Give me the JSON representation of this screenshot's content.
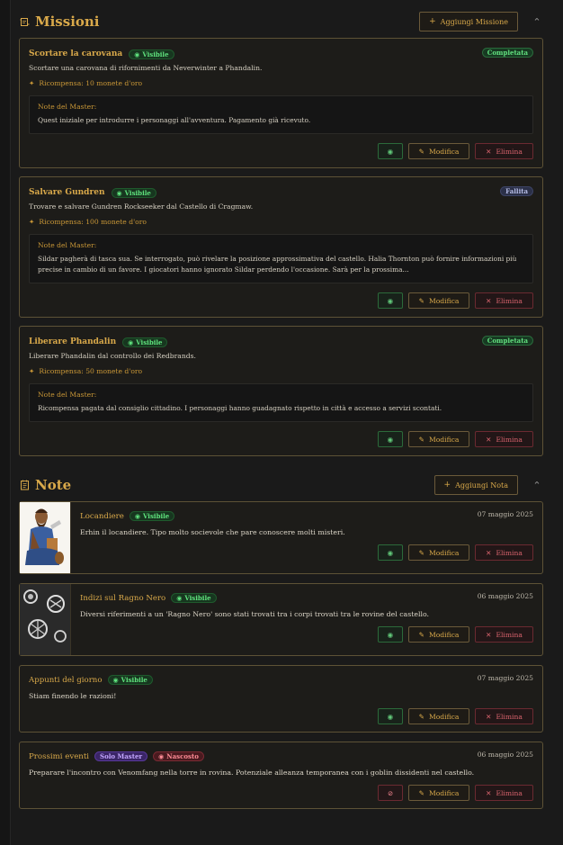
{
  "missions": {
    "title": "Missioni",
    "add_label": "Aggiungi Missione",
    "items": [
      {
        "title": "Scortare la carovana",
        "visibility": "Visibile",
        "status": "Completata",
        "description": "Scortare una carovana di rifornimenti da Neverwinter a Phandalin.",
        "reward": "Ricompensa: 10 monete d'oro",
        "master_label": "Note del Master:",
        "master_text": "Quest iniziale per introdurre i personaggi all'avventura. Pagamento già ricevuto."
      },
      {
        "title": "Salvare Gundren",
        "visibility": "Visibile",
        "status": "Fallita",
        "description": "Trovare e salvare Gundren Rockseeker dal Castello di Cragmaw.",
        "reward": "Ricompensa: 100 monete d'oro",
        "master_label": "Note del Master:",
        "master_text": "Sildar pagherà di tasca sua. Se interrogato, può rivelare la posizione approssimativa del castello. Halia Thornton può fornire informazioni più precise in cambio di un favore. I giocatori hanno ignorato Sildar perdendo l'occasione. Sarà per la prossima..."
      },
      {
        "title": "Liberare Phandalin",
        "visibility": "Visibile",
        "status": "Completata",
        "description": "Liberare Phandalin dal controllo dei Redbrands.",
        "reward": "Ricompensa: 50 monete d'oro",
        "master_label": "Note del Master:",
        "master_text": "Ricompensa pagata dal consiglio cittadino. I personaggi hanno guadagnato rispetto in città e accesso a servizi scontati."
      }
    ]
  },
  "notes": {
    "title": "Note",
    "add_label": "Aggiungi Nota",
    "items": [
      {
        "title": "Locandiere",
        "badge1": "Visibile",
        "date": "07 maggio 2025",
        "text": "Erhin il locandiere. Tipo molto socievole che pare conoscere molti misteri."
      },
      {
        "title": "Indizi sul Ragno Nero",
        "badge1": "Visibile",
        "date": "06 maggio 2025",
        "text": "Diversi riferimenti a un 'Ragno Nero' sono stati trovati tra i corpi trovati tra le rovine del castello."
      },
      {
        "title": "Appunti del giorno",
        "badge1": "Visibile",
        "date": "07 maggio 2025",
        "text": "Stiam finendo le razioni!"
      },
      {
        "title": "Prossimi eventi",
        "badge1": "Solo Master",
        "badge2": "Nascosto",
        "date": "06 maggio 2025",
        "text": "Preparare l'incontro con Venomfang nella torre in rovina. Potenziale alleanza temporanea con i goblin dissidenti nel castello."
      }
    ]
  },
  "actions": {
    "edit": "Modifica",
    "delete": "Elimina"
  },
  "icons": {
    "missions": "scroll-icon",
    "notes": "notepad-icon",
    "add": "plus-icon",
    "collapse": "chevron-up-icon",
    "reward": "sparkle-icon",
    "visible": "eye-icon",
    "hidden": "eye-off-icon",
    "edit": "pencil-icon",
    "delete": "x-icon"
  },
  "colors": {
    "accent": "#d9a94a",
    "success": "#62e07f",
    "danger": "#d9636d",
    "master": "#c3a6ff"
  }
}
